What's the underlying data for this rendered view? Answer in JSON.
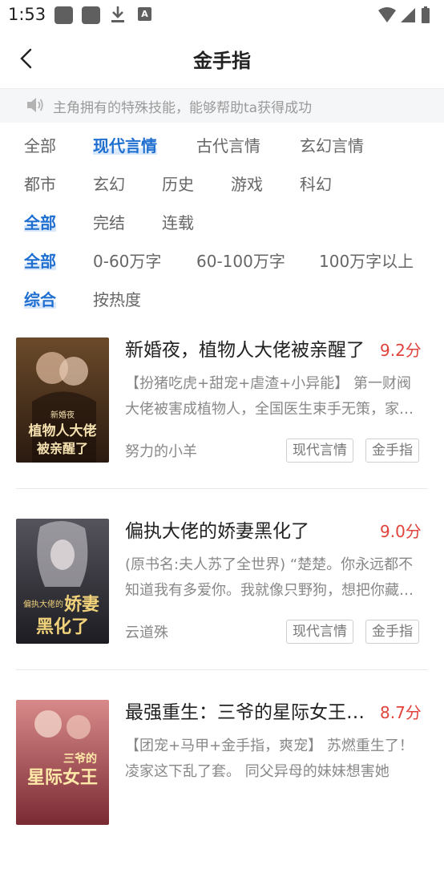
{
  "status_bar": {
    "time": "1:53",
    "notification_icon": "A"
  },
  "header": {
    "title": "金手指"
  },
  "notice": {
    "text": "主角拥有的特殊技能，能够帮助ta获得成功"
  },
  "filters": {
    "row1": [
      "全部",
      "现代言情",
      "古代言情",
      "玄幻言情"
    ],
    "row2": [
      "都市",
      "玄幻",
      "历史",
      "游戏",
      "科幻"
    ],
    "status": [
      "全部",
      "完结",
      "连载"
    ],
    "word_count": [
      "全部",
      "0-60万字",
      "60-100万字",
      "100万字以上"
    ],
    "sort": [
      "综合",
      "按热度"
    ]
  },
  "books": [
    {
      "title": "新婚夜，植物人大佬被亲醒了",
      "score": "9.2分",
      "desc": "【扮猪吃虎+甜宠+虐渣+小异能】 第一财阀大佬被害成植物人，全国医生束手无策，家族为他娶了一个冲喜新娘",
      "author": "努力的小羊",
      "tags": [
        "现代言情",
        "金手指"
      ],
      "cover_text": [
        "新婚夜",
        "植物人大佬",
        "被亲醒了"
      ],
      "cover_colors": [
        "#2a1a10",
        "#6b4a2a"
      ]
    },
    {
      "title": "偏执大佬的娇妻黑化了",
      "score": "9.0分",
      "desc": "(原书名:夫人苏了全世界) “楚楚。你永远都不知道我有多爱你。我就像只野狗，想把你藏起来",
      "author": "云道殊",
      "tags": [
        "现代言情",
        "金手指"
      ],
      "cover_text": [
        "偏执大佬的",
        "娇妻",
        "黑化了"
      ],
      "cover_colors": [
        "#1c1c22",
        "#55535c"
      ]
    },
    {
      "title": "最强重生：三爷的星际女王大人",
      "score": "8.7分",
      "desc": "【团宠+马甲+金手指，爽宠】 苏燃重生了！凌家这下乱了套。 同父异母的妹妹想害她",
      "author": "",
      "tags": [],
      "cover_text": [
        "三爷的",
        "星际女王"
      ],
      "cover_colors": [
        "#7a2a33",
        "#d88a8a"
      ]
    }
  ],
  "colors": {
    "accent": "#1f6fd0",
    "score": "#e0433b",
    "muted": "#888888"
  }
}
